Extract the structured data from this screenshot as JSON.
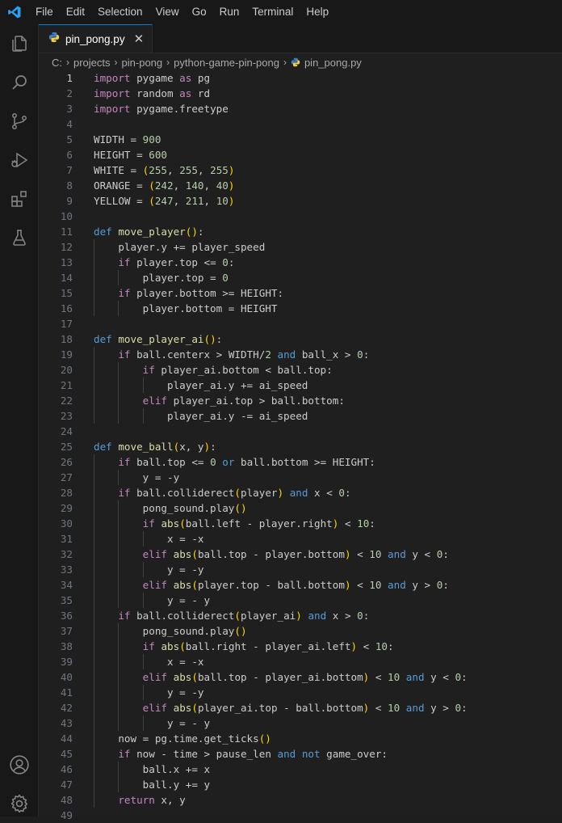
{
  "menu": [
    "File",
    "Edit",
    "Selection",
    "View",
    "Go",
    "Run",
    "Terminal",
    "Help"
  ],
  "activity_icons": [
    "explorer-icon",
    "search-icon",
    "source-control-icon",
    "run-debug-icon",
    "extensions-icon",
    "testing-icon"
  ],
  "activity_bottom_icons": [
    "account-icon",
    "settings-gear-icon"
  ],
  "tab": {
    "filename": "pin_pong.py",
    "close": "✕"
  },
  "breadcrumb": [
    "C:",
    "projects",
    "pin-pong",
    "python-game-pin-pong",
    "pin_pong.py"
  ],
  "colors": {
    "keyword": "#569cd6",
    "control": "#c586c0",
    "function": "#dcdcaa",
    "number": "#b5cea8",
    "accent": "#0078d4"
  },
  "current_line": 1,
  "code": [
    [
      [
        "import",
        "ctl"
      ],
      [
        " pygame ",
        "pl"
      ],
      [
        "as",
        "ctl"
      ],
      [
        " pg",
        "pl"
      ]
    ],
    [
      [
        "import",
        "ctl"
      ],
      [
        " random ",
        "pl"
      ],
      [
        "as",
        "ctl"
      ],
      [
        " rd",
        "pl"
      ]
    ],
    [
      [
        "import",
        "ctl"
      ],
      [
        " pygame.freetype",
        "pl"
      ]
    ],
    [],
    [
      [
        "WIDTH = ",
        "pl"
      ],
      [
        "900",
        "num"
      ]
    ],
    [
      [
        "HEIGHT = ",
        "pl"
      ],
      [
        "600",
        "num"
      ]
    ],
    [
      [
        "WHITE = ",
        "pl"
      ],
      [
        "(",
        "br1"
      ],
      [
        "255",
        "num"
      ],
      [
        ", ",
        "pl"
      ],
      [
        "255",
        "num"
      ],
      [
        ", ",
        "pl"
      ],
      [
        "255",
        "num"
      ],
      [
        ")",
        "br1"
      ]
    ],
    [
      [
        "ORANGE = ",
        "pl"
      ],
      [
        "(",
        "br1"
      ],
      [
        "242",
        "num"
      ],
      [
        ", ",
        "pl"
      ],
      [
        "140",
        "num"
      ],
      [
        ", ",
        "pl"
      ],
      [
        "40",
        "num"
      ],
      [
        ")",
        "br1"
      ]
    ],
    [
      [
        "YELLOW = ",
        "pl"
      ],
      [
        "(",
        "br1"
      ],
      [
        "247",
        "num"
      ],
      [
        ", ",
        "pl"
      ],
      [
        "211",
        "num"
      ],
      [
        ", ",
        "pl"
      ],
      [
        "10",
        "num"
      ],
      [
        ")",
        "br1"
      ]
    ],
    [],
    [
      [
        "def",
        "kw"
      ],
      [
        " ",
        "pl"
      ],
      [
        "move_player",
        "fn"
      ],
      [
        "()",
        "br1"
      ],
      [
        ":",
        "pl"
      ]
    ],
    [
      [
        "    player.y += player_speed",
        "pl"
      ]
    ],
    [
      [
        "    ",
        "pl"
      ],
      [
        "if",
        "ctl"
      ],
      [
        " player.top <= ",
        "pl"
      ],
      [
        "0",
        "num"
      ],
      [
        ":",
        "pl"
      ]
    ],
    [
      [
        "        player.top = ",
        "pl"
      ],
      [
        "0",
        "num"
      ]
    ],
    [
      [
        "    ",
        "pl"
      ],
      [
        "if",
        "ctl"
      ],
      [
        " player.bottom >= HEIGHT:",
        "pl"
      ]
    ],
    [
      [
        "        player.bottom = HEIGHT",
        "pl"
      ]
    ],
    [],
    [
      [
        "def",
        "kw"
      ],
      [
        " ",
        "pl"
      ],
      [
        "move_player_ai",
        "fn"
      ],
      [
        "()",
        "br1"
      ],
      [
        ":",
        "pl"
      ]
    ],
    [
      [
        "    ",
        "pl"
      ],
      [
        "if",
        "ctl"
      ],
      [
        " ball.centerx > WIDTH/",
        "pl"
      ],
      [
        "2",
        "num"
      ],
      [
        " ",
        "pl"
      ],
      [
        "and",
        "kw"
      ],
      [
        " ball_x > ",
        "pl"
      ],
      [
        "0",
        "num"
      ],
      [
        ":",
        "pl"
      ]
    ],
    [
      [
        "        ",
        "pl"
      ],
      [
        "if",
        "ctl"
      ],
      [
        " player_ai.bottom < ball.top:",
        "pl"
      ]
    ],
    [
      [
        "            player_ai.y += ai_speed",
        "pl"
      ]
    ],
    [
      [
        "        ",
        "pl"
      ],
      [
        "elif",
        "ctl"
      ],
      [
        " player_ai.top > ball.bottom:",
        "pl"
      ]
    ],
    [
      [
        "            player_ai.y -= ai_speed",
        "pl"
      ]
    ],
    [],
    [
      [
        "def",
        "kw"
      ],
      [
        " ",
        "pl"
      ],
      [
        "move_ball",
        "fn"
      ],
      [
        "(",
        "br1"
      ],
      [
        "x, y",
        "pl"
      ],
      [
        ")",
        "br1"
      ],
      [
        ":",
        "pl"
      ]
    ],
    [
      [
        "    ",
        "pl"
      ],
      [
        "if",
        "ctl"
      ],
      [
        " ball.top <= ",
        "pl"
      ],
      [
        "0",
        "num"
      ],
      [
        " ",
        "pl"
      ],
      [
        "or",
        "kw"
      ],
      [
        " ball.bottom >= HEIGHT:",
        "pl"
      ]
    ],
    [
      [
        "        y = -y",
        "pl"
      ]
    ],
    [
      [
        "    ",
        "pl"
      ],
      [
        "if",
        "ctl"
      ],
      [
        " ball.colliderect",
        "pl"
      ],
      [
        "(",
        "br1"
      ],
      [
        "player",
        "pl"
      ],
      [
        ")",
        "br1"
      ],
      [
        " ",
        "pl"
      ],
      [
        "and",
        "kw"
      ],
      [
        " x < ",
        "pl"
      ],
      [
        "0",
        "num"
      ],
      [
        ":",
        "pl"
      ]
    ],
    [
      [
        "        pong_sound.play",
        "pl"
      ],
      [
        "()",
        "br1"
      ]
    ],
    [
      [
        "        ",
        "pl"
      ],
      [
        "if",
        "ctl"
      ],
      [
        " ",
        "pl"
      ],
      [
        "abs",
        "fn"
      ],
      [
        "(",
        "br1"
      ],
      [
        "ball.left - player.right",
        "pl"
      ],
      [
        ")",
        "br1"
      ],
      [
        " < ",
        "pl"
      ],
      [
        "10",
        "num"
      ],
      [
        ":",
        "pl"
      ]
    ],
    [
      [
        "            x = -x",
        "pl"
      ]
    ],
    [
      [
        "        ",
        "pl"
      ],
      [
        "elif",
        "ctl"
      ],
      [
        " ",
        "pl"
      ],
      [
        "abs",
        "fn"
      ],
      [
        "(",
        "br1"
      ],
      [
        "ball.top - player.bottom",
        "pl"
      ],
      [
        ")",
        "br1"
      ],
      [
        " < ",
        "pl"
      ],
      [
        "10",
        "num"
      ],
      [
        " ",
        "pl"
      ],
      [
        "and",
        "kw"
      ],
      [
        " y < ",
        "pl"
      ],
      [
        "0",
        "num"
      ],
      [
        ":",
        "pl"
      ]
    ],
    [
      [
        "            y = -y",
        "pl"
      ]
    ],
    [
      [
        "        ",
        "pl"
      ],
      [
        "elif",
        "ctl"
      ],
      [
        " ",
        "pl"
      ],
      [
        "abs",
        "fn"
      ],
      [
        "(",
        "br1"
      ],
      [
        "player.top - ball.bottom",
        "pl"
      ],
      [
        ")",
        "br1"
      ],
      [
        " < ",
        "pl"
      ],
      [
        "10",
        "num"
      ],
      [
        " ",
        "pl"
      ],
      [
        "and",
        "kw"
      ],
      [
        " y > ",
        "pl"
      ],
      [
        "0",
        "num"
      ],
      [
        ":",
        "pl"
      ]
    ],
    [
      [
        "            y = - y",
        "pl"
      ]
    ],
    [
      [
        "    ",
        "pl"
      ],
      [
        "if",
        "ctl"
      ],
      [
        " ball.colliderect",
        "pl"
      ],
      [
        "(",
        "br1"
      ],
      [
        "player_ai",
        "pl"
      ],
      [
        ")",
        "br1"
      ],
      [
        " ",
        "pl"
      ],
      [
        "and",
        "kw"
      ],
      [
        " x > ",
        "pl"
      ],
      [
        "0",
        "num"
      ],
      [
        ":",
        "pl"
      ]
    ],
    [
      [
        "        pong_sound.play",
        "pl"
      ],
      [
        "()",
        "br1"
      ]
    ],
    [
      [
        "        ",
        "pl"
      ],
      [
        "if",
        "ctl"
      ],
      [
        " ",
        "pl"
      ],
      [
        "abs",
        "fn"
      ],
      [
        "(",
        "br1"
      ],
      [
        "ball.right - player_ai.left",
        "pl"
      ],
      [
        ")",
        "br1"
      ],
      [
        " < ",
        "pl"
      ],
      [
        "10",
        "num"
      ],
      [
        ":",
        "pl"
      ]
    ],
    [
      [
        "            x = -x",
        "pl"
      ]
    ],
    [
      [
        "        ",
        "pl"
      ],
      [
        "elif",
        "ctl"
      ],
      [
        " ",
        "pl"
      ],
      [
        "abs",
        "fn"
      ],
      [
        "(",
        "br1"
      ],
      [
        "ball.top - player_ai.bottom",
        "pl"
      ],
      [
        ")",
        "br1"
      ],
      [
        " < ",
        "pl"
      ],
      [
        "10",
        "num"
      ],
      [
        " ",
        "pl"
      ],
      [
        "and",
        "kw"
      ],
      [
        " y < ",
        "pl"
      ],
      [
        "0",
        "num"
      ],
      [
        ":",
        "pl"
      ]
    ],
    [
      [
        "            y = -y",
        "pl"
      ]
    ],
    [
      [
        "        ",
        "pl"
      ],
      [
        "elif",
        "ctl"
      ],
      [
        " ",
        "pl"
      ],
      [
        "abs",
        "fn"
      ],
      [
        "(",
        "br1"
      ],
      [
        "player_ai.top - ball.bottom",
        "pl"
      ],
      [
        ")",
        "br1"
      ],
      [
        " < ",
        "pl"
      ],
      [
        "10",
        "num"
      ],
      [
        " ",
        "pl"
      ],
      [
        "and",
        "kw"
      ],
      [
        " y > ",
        "pl"
      ],
      [
        "0",
        "num"
      ],
      [
        ":",
        "pl"
      ]
    ],
    [
      [
        "            y = - y",
        "pl"
      ]
    ],
    [
      [
        "    now = pg.time.get_ticks",
        "pl"
      ],
      [
        "()",
        "br1"
      ]
    ],
    [
      [
        "    ",
        "pl"
      ],
      [
        "if",
        "ctl"
      ],
      [
        " now - time > pause_len ",
        "pl"
      ],
      [
        "and",
        "kw"
      ],
      [
        " ",
        "pl"
      ],
      [
        "not",
        "kw"
      ],
      [
        " game_over:",
        "pl"
      ]
    ],
    [
      [
        "        ball.x += x",
        "pl"
      ]
    ],
    [
      [
        "        ball.y += y",
        "pl"
      ]
    ],
    [
      [
        "    ",
        "pl"
      ],
      [
        "return",
        "ctl"
      ],
      [
        " x, y",
        "pl"
      ]
    ],
    []
  ]
}
